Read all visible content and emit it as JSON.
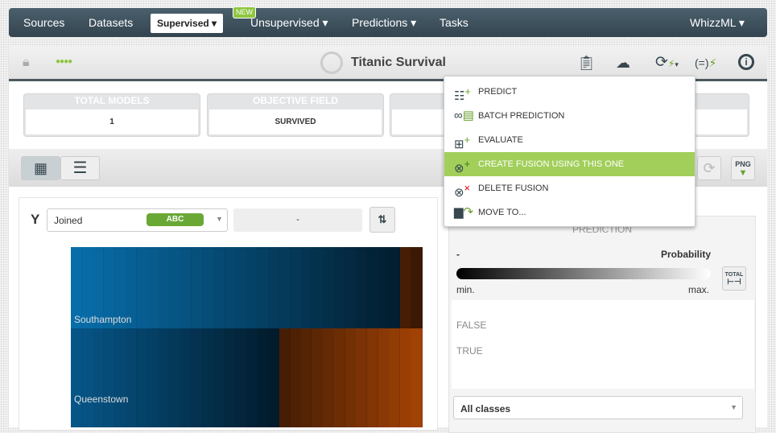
{
  "nav": {
    "items": [
      "Sources",
      "Datasets",
      "Supervised",
      "Unsupervised",
      "Predictions",
      "Tasks"
    ],
    "new_badge": "NEW",
    "right": "WhizzML"
  },
  "toolbar": {
    "title": "Titanic Survival",
    "status_dots": "●●●●"
  },
  "cards": [
    {
      "label": "TOTAL MODELS",
      "value": "1"
    },
    {
      "label": "OBJECTIVE FIELD",
      "value": "SURVIVED"
    },
    {
      "label": "",
      "value": ""
    },
    {
      "label": "",
      "value": ""
    }
  ],
  "menu": {
    "items": [
      {
        "label": "PREDICT",
        "icon": "predict-icon"
      },
      {
        "label": "BATCH PREDICTION",
        "icon": "batch-prediction-icon"
      },
      {
        "label": "EVALUATE",
        "icon": "evaluate-icon"
      },
      {
        "label": "CREATE FUSION USING THIS ONE",
        "icon": "create-fusion-icon",
        "active": true
      },
      {
        "label": "DELETE FUSION",
        "icon": "delete-fusion-icon"
      },
      {
        "label": "MOVE TO...",
        "icon": "move-to-icon"
      }
    ]
  },
  "chart": {
    "y_label": "Y",
    "y_field": "Joined",
    "y_type": "ABC",
    "x_field": "-",
    "rows": [
      "Southampton",
      "Queenstown"
    ]
  },
  "panel": {
    "header": "PREDICTION",
    "field": "-",
    "legend_title": "Probability",
    "min": "min.",
    "max": "max.",
    "total_btn": "TOTAL",
    "classes": [
      "FALSE",
      "TRUE"
    ],
    "filter": "All classes",
    "png": "PNG"
  },
  "colors": {
    "accent": "#8dc63f",
    "highlight": "#a2cf5a",
    "nav": "#3f5462",
    "blue": "#0a6eaa",
    "orange": "#a04000"
  }
}
